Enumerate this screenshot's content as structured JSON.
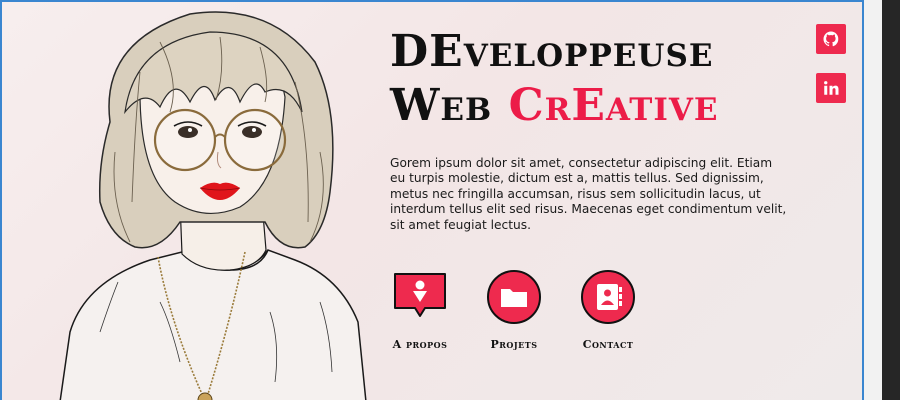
{
  "hero": {
    "title_line1": "DEveloppeuse",
    "title_line2_dark": "Web",
    "title_line2_accent": "CrEative",
    "description": "Gorem ipsum dolor sit amet, consectetur adipiscing elit. Etiam eu turpis molestie, dictum est a, mattis tellus. Sed dignissim, metus nec fringilla accumsan, risus sem sollicitudin lacus, ut interdum tellus elit sed risus. Maecenas eget condimentum velit, sit amet feugiat lectus."
  },
  "actions": [
    {
      "label": "A propos",
      "icon": "chat-download-icon"
    },
    {
      "label": "Projets",
      "icon": "folder-icon"
    },
    {
      "label": "Contact",
      "icon": "contact-book-icon"
    }
  ],
  "social": [
    {
      "icon": "github-icon"
    },
    {
      "icon": "linkedin-icon"
    }
  ],
  "colors": {
    "accent": "#ec1c48",
    "text": "#111111",
    "frame_border": "#3a86d0"
  }
}
